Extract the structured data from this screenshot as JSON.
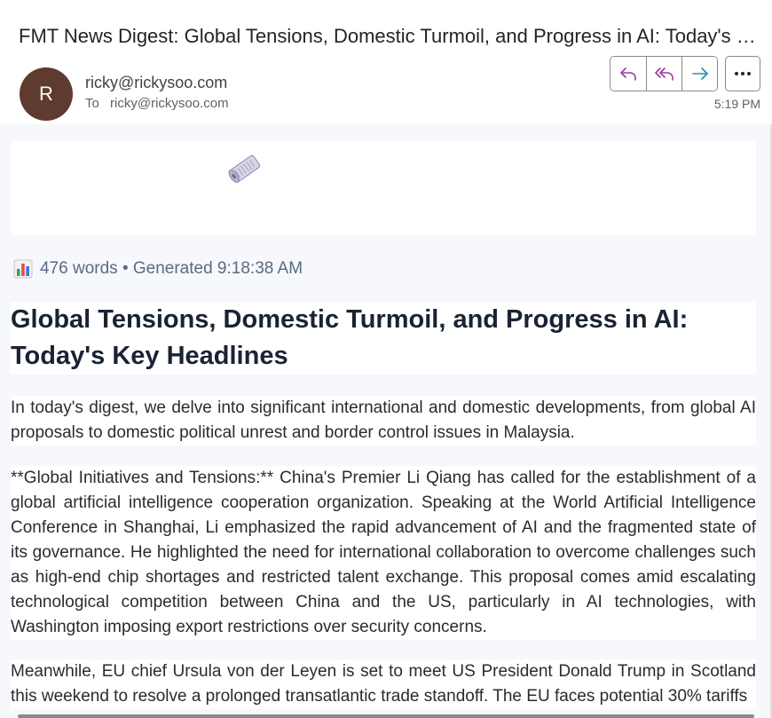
{
  "email": {
    "subject": "FMT News Digest: Global Tensions, Domestic Turmoil, and Progress in AI: Today's Key Headlines",
    "avatar_initial": "R",
    "avatar_color": "#5e3b2e",
    "sender": "ricky@rickysoo.com",
    "to_label": "To",
    "recipient": "ricky@rickysoo.com",
    "time": "5:19 PM"
  },
  "actions": {
    "reply_icon": "reply-icon",
    "reply_all_icon": "reply-all-icon",
    "forward_icon": "forward-icon",
    "more_icon": "more-icon"
  },
  "digest": {
    "hero_icon": "newspaper-icon",
    "meta_icon": "bar-chart-icon",
    "meta": "476 words • Generated 9:18:38 AM",
    "headline": "Global Tensions, Domestic Turmoil, and Progress in AI: Today's Key Headlines",
    "paragraphs": [
      "In today's digest, we delve into significant international and domestic developments, from global AI proposals to domestic political unrest and border control issues in Malaysia.",
      "**Global Initiatives and Tensions:** China's Premier Li Qiang has called for the establishment of a global artificial intelligence cooperation organization. Speaking at the World Artificial Intelligence Conference in Shanghai, Li emphasized the rapid advancement of AI and the fragmented state of its governance. He highlighted the need for international collaboration to overcome challenges such as high-end chip shortages and restricted talent exchange. This proposal comes amid escalating technological competition between China and the US, particularly in AI technologies, with Washington imposing export restrictions over security concerns.",
      "Meanwhile, EU chief Ursula von der Leyen is set to meet US President Donald Trump in Scotland this weekend to resolve a prolonged transatlantic trade standoff. The EU faces potential 30% tariffs"
    ]
  }
}
